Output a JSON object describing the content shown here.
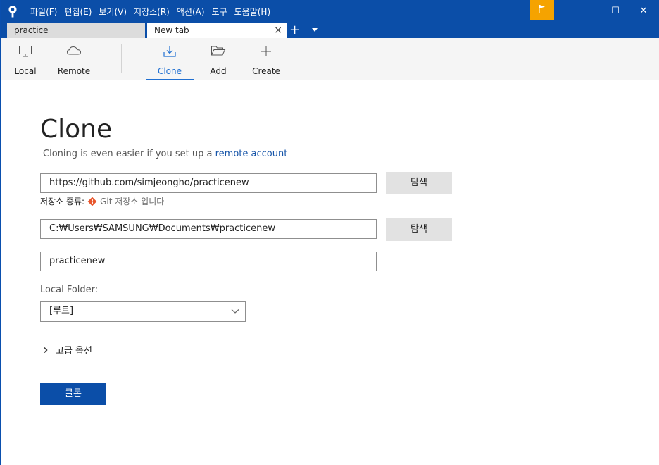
{
  "menu": {
    "items": [
      "파일(F)",
      "편집(E)",
      "보기(V)",
      "저장소(R)",
      "액션(A)",
      "도구",
      "도움말(H)"
    ]
  },
  "window_controls": {
    "minimize": "—",
    "maximize": "☐",
    "close": "✕"
  },
  "tabs": [
    {
      "label": "practice",
      "active": false
    },
    {
      "label": "New tab",
      "active": true
    }
  ],
  "tab_close": "×",
  "tab_add": "+",
  "toolbar": {
    "local": "Local",
    "remote": "Remote",
    "clone": "Clone",
    "add": "Add",
    "create": "Create"
  },
  "clone_page": {
    "title": "Clone",
    "subtitle_prefix": "Cloning is even easier if you set up a ",
    "subtitle_link": "remote account",
    "source_url": "https://github.com/simjeongho/practicenew",
    "browse_label": "탐색",
    "repo_type_label": "저장소 종류:",
    "repo_type_value": "Git 저장소 입니다",
    "destination_path": "C:₩Users₩SAMSUNG₩Documents₩practicenew",
    "name": "practicenew",
    "local_folder_label": "Local Folder:",
    "local_folder_value": "[루트]",
    "advanced_options": "고급 옵션",
    "clone_button": "클론"
  },
  "colors": {
    "titlebar": "#0b4ea8",
    "accent": "#1f6fd1",
    "flag": "#f5a300",
    "git": "#e8552b"
  }
}
